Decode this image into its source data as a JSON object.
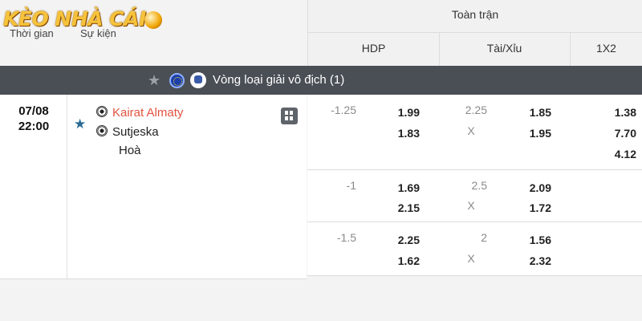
{
  "logo": {
    "text": "KÈO NHÀ CÁI"
  },
  "header": {
    "time_label": "Thời gian",
    "event_label": "Sự kiện",
    "full_match": "Toàn trận",
    "hdp": "HDP",
    "tai_xiu": "Tài/Xỉu",
    "x12": "1X2"
  },
  "league": {
    "name": "Vòng loại giải vô địch (1)"
  },
  "match": {
    "date": "07/08",
    "time": "22:00",
    "home": "Kairat Almaty",
    "away": "Sutjeska",
    "draw": "Hoà"
  },
  "odds": [
    {
      "hdp_line": "-1.25",
      "hdp_home": "1.99",
      "hdp_away": "1.83",
      "ou_line": "2.25",
      "ou_x": "X",
      "ou_over": "1.85",
      "ou_under": "1.95",
      "x12_1": "1.38",
      "x12_2": "7.70",
      "x12_x": "4.12"
    },
    {
      "hdp_line": "-1",
      "hdp_home": "1.69",
      "hdp_away": "2.15",
      "ou_line": "2.5",
      "ou_x": "X",
      "ou_over": "2.09",
      "ou_under": "1.72"
    },
    {
      "hdp_line": "-1.5",
      "hdp_home": "2.25",
      "hdp_away": "1.62",
      "ou_line": "2",
      "ou_x": "X",
      "ou_over": "1.56",
      "ou_under": "2.32"
    }
  ],
  "colors": {
    "league_bar": "#4a4f56",
    "home_team": "#e2533f",
    "fav_star": "#2b6a93"
  }
}
